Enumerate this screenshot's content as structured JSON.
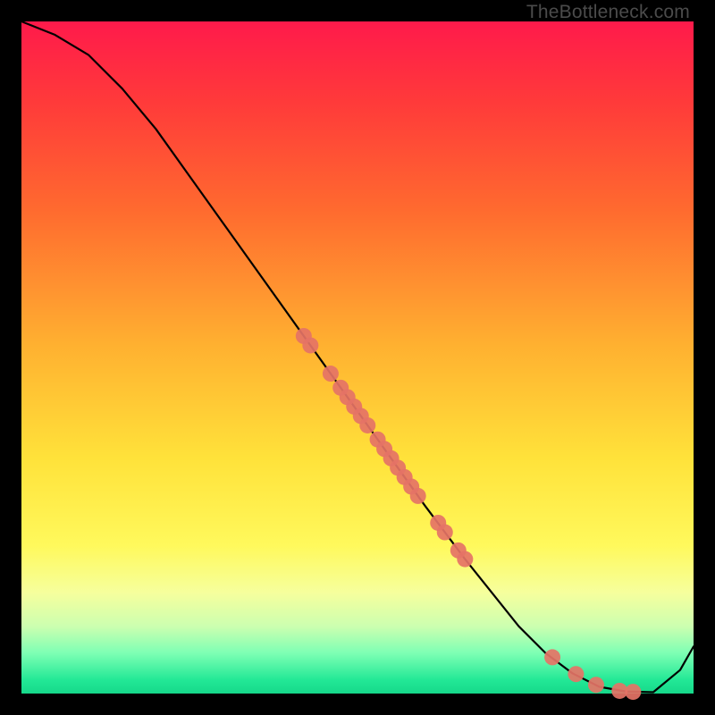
{
  "watermark": "TheBottleneck.com",
  "chart_data": {
    "type": "line",
    "title": "",
    "xlabel": "",
    "ylabel": "",
    "xlim": [
      0,
      100
    ],
    "ylim": [
      0,
      100
    ],
    "grid": false,
    "legend": false,
    "series": [
      {
        "name": "curve",
        "color": "#000000",
        "x": [
          0,
          5,
          10,
          15,
          20,
          25,
          30,
          35,
          40,
          45,
          50,
          55,
          60,
          63,
          66,
          70,
          74,
          78,
          82,
          86,
          90,
          94,
          98,
          100
        ],
        "y": [
          100,
          98,
          95,
          90,
          84,
          77,
          70,
          63,
          56,
          49,
          42,
          35,
          28,
          24,
          20,
          15,
          10,
          6,
          3,
          1,
          0.3,
          0.2,
          3.5,
          7
        ]
      }
    ],
    "points": {
      "name": "markers",
      "color": "#e57366",
      "radius": 9,
      "xy": [
        [
          42,
          53.2
        ],
        [
          43,
          51.8
        ],
        [
          46,
          47.6
        ],
        [
          47.5,
          45.5
        ],
        [
          48.5,
          44.1
        ],
        [
          49.5,
          42.7
        ],
        [
          50.5,
          41.3
        ],
        [
          51.5,
          39.9
        ],
        [
          53,
          37.8
        ],
        [
          54,
          36.4
        ],
        [
          55,
          35.0
        ],
        [
          56,
          33.6
        ],
        [
          57,
          32.2
        ],
        [
          58,
          30.8
        ],
        [
          59,
          29.4
        ],
        [
          62,
          25.4
        ],
        [
          63,
          24.0
        ],
        [
          65,
          21.3
        ],
        [
          66,
          20.0
        ],
        [
          79,
          5.4
        ],
        [
          82.5,
          2.9
        ],
        [
          85.5,
          1.3
        ],
        [
          89,
          0.4
        ],
        [
          91,
          0.25
        ]
      ]
    }
  }
}
